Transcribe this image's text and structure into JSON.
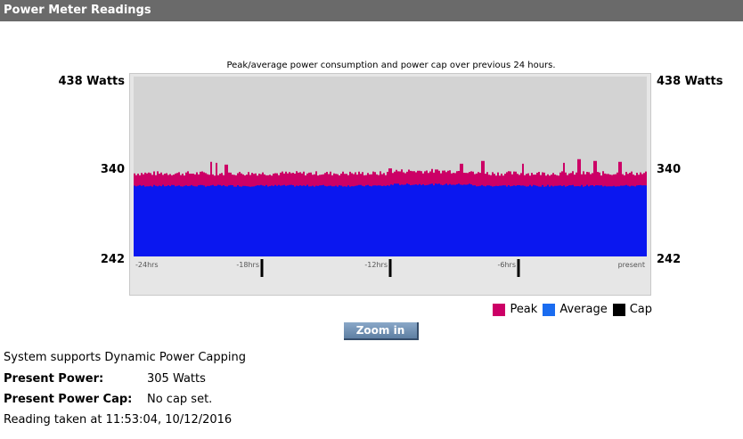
{
  "header": {
    "title": "Power Meter Readings"
  },
  "chart_data": {
    "type": "area",
    "title": "Peak/average power consumption and power cap over previous 24 hours.",
    "y_axis": {
      "max_label": "438 Watts",
      "mid_label": "340",
      "min_label": "242",
      "ylim": [
        242,
        438
      ]
    },
    "x_ticks": [
      "-24hrs",
      "-18hrs",
      "-12hrs",
      "-6hrs",
      "present"
    ],
    "legend_position": "bottom-right",
    "series": [
      {
        "name": "Peak",
        "color": "#cc0066",
        "baseline": 330,
        "spikes": [
          [
            0.15,
            345
          ],
          [
            0.16,
            344
          ],
          [
            0.18,
            342
          ],
          [
            0.5,
            338
          ],
          [
            0.64,
            343
          ],
          [
            0.68,
            346
          ],
          [
            0.76,
            343
          ],
          [
            0.84,
            344
          ],
          [
            0.87,
            348
          ],
          [
            0.9,
            346
          ],
          [
            0.95,
            345
          ]
        ]
      },
      {
        "name": "Average",
        "color": "#0a17f0",
        "baseline": 318
      },
      {
        "name": "Cap",
        "color": "#000000"
      }
    ]
  },
  "controls": {
    "zoom_in": "Zoom in"
  },
  "info": {
    "dynamic_capping": "System supports Dynamic Power Capping",
    "present_power_label": "Present Power:",
    "present_power_value": "305 Watts",
    "power_cap_label": "Present Power Cap:",
    "power_cap_value": "No cap set.",
    "reading": "Reading taken at 11:53:04, 10/12/2016"
  }
}
